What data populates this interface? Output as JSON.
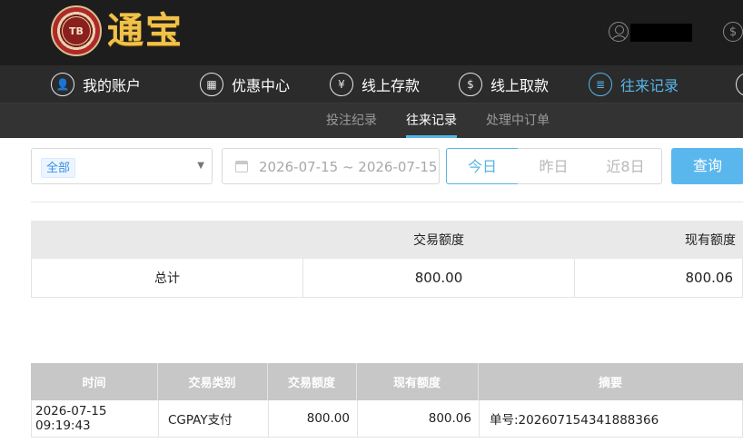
{
  "header": {
    "logo_text": "TB",
    "brand": "通宝"
  },
  "nav": {
    "items": [
      {
        "label": "我的账户",
        "icon": "user-icon"
      },
      {
        "label": "优惠中心",
        "icon": "gift-icon"
      },
      {
        "label": "线上存款",
        "icon": "deposit-icon"
      },
      {
        "label": "线上取款",
        "icon": "withdraw-icon"
      },
      {
        "label": "往来记录",
        "icon": "records-icon",
        "active": true
      }
    ]
  },
  "subnav": {
    "items": [
      {
        "label": "投注纪录"
      },
      {
        "label": "往来记录",
        "active": true
      },
      {
        "label": "处理中订单"
      }
    ]
  },
  "filters": {
    "type_tag": "全部",
    "date_range": "2026-07-15 ~ 2026-07-15",
    "quick": [
      "今日",
      "昨日",
      "近8日"
    ],
    "selected_quick": "今日",
    "query_label": "查询"
  },
  "summary": {
    "headers": [
      "交易额度",
      "现有额度"
    ],
    "row": {
      "label": "总计",
      "amount": "800.00",
      "balance": "800.06"
    }
  },
  "details": {
    "headers": [
      "时间",
      "交易类别",
      "交易额度",
      "现有额度",
      "摘要"
    ],
    "rows": [
      {
        "time": "2026-07-15 09:19:43",
        "type": "CGPAY支付",
        "amount": "800.00",
        "balance": "800.06",
        "note": "单号:202607154341888366"
      }
    ]
  },
  "colors": {
    "accent": "#57b5e6",
    "query_button": "#5ab7ee",
    "header_bg": "#1d1d1d",
    "nav_bg": "#2b2b2b",
    "brand_gold": "#f0c24a"
  }
}
